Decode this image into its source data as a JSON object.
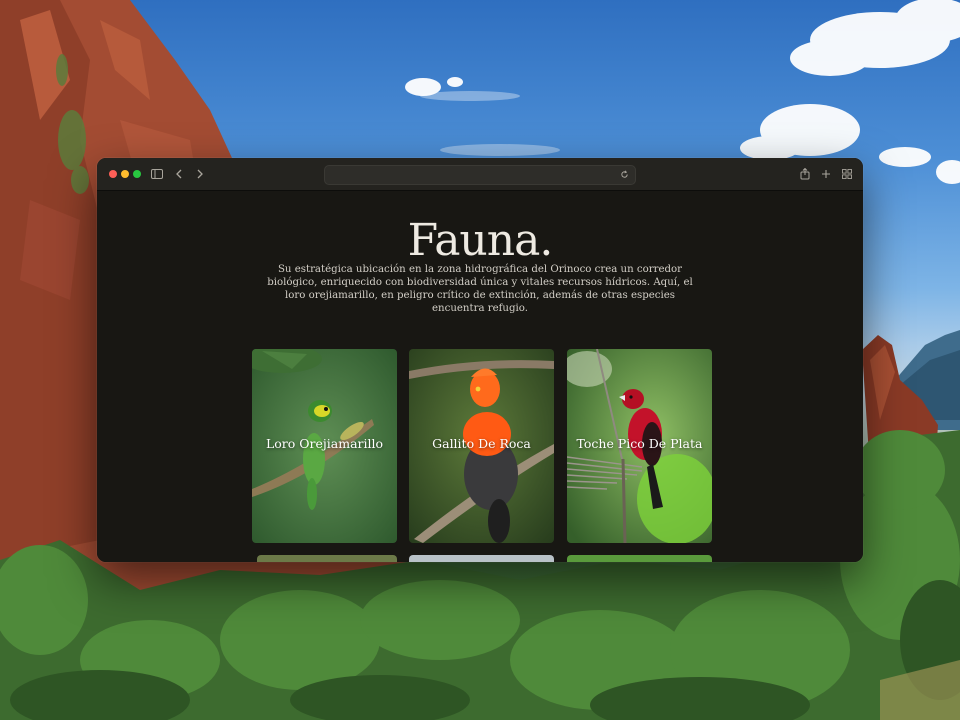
{
  "page": {
    "title": "Fauna.",
    "intro": "Su estratégica ubicación en la zona hidrográfica del Orinoco crea un corredor biológico, enriquecido con biodiversidad única y vitales recursos hídricos. Aquí, el loro orejiamarillo, en peligro crítico de extinción, además de otras especies encuentra refugio."
  },
  "cards": [
    {
      "name": "Loro Orejiamarillo",
      "colors": [
        "#3f7c3a",
        "#c9d627"
      ]
    },
    {
      "name": "Gallito De Roca",
      "colors": [
        "#ff5a14",
        "#2f2f2f"
      ]
    },
    {
      "name": "Toche Pico De Plata",
      "colors": [
        "#c3122a",
        "#1a1a1a"
      ]
    }
  ],
  "toolbar": {
    "icons": [
      "sidebar-icon",
      "back-icon",
      "forward-icon",
      "reload-icon",
      "share-icon",
      "new-tab-icon",
      "tab-overview-icon"
    ]
  },
  "theme": {
    "page_bg": "#181713",
    "toolbar_bg": "#24231f",
    "title_color": "#eeeae2"
  }
}
